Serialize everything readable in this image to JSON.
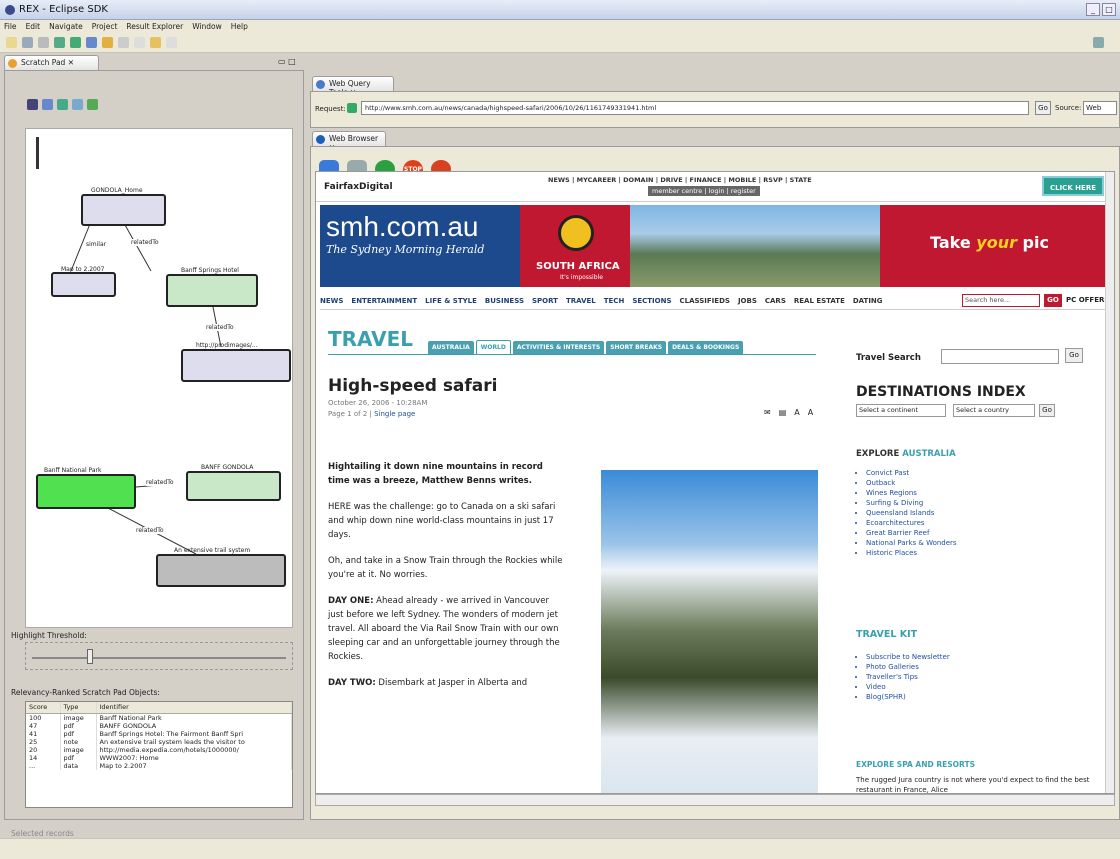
{
  "window": {
    "title": "REX - Eclipse SDK"
  },
  "menu": [
    "File",
    "Edit",
    "Navigate",
    "Project",
    "Result Explorer",
    "Window",
    "Help"
  ],
  "scratch": {
    "tab": "Scratch Pad",
    "nodes": [
      {
        "title": "GONDOLA_Home",
        "label": ""
      },
      {
        "title": "Map to 2.2007",
        "label": "image"
      },
      {
        "title": "Banff Springs Hotel",
        "label": ""
      },
      {
        "title": "http://prodimages/...",
        "label": ""
      },
      {
        "title": "Banff National Park",
        "label": "image"
      },
      {
        "title": "BANFF GONDOLA",
        "label": ""
      },
      {
        "title": "An extensive trail system",
        "label": ""
      }
    ],
    "edges": [
      "similar",
      "relatedTo",
      "relatedTo",
      "relatedTo",
      "relatedTo"
    ],
    "threshold_label": "Highlight Threshold:",
    "threshold_value": 0.22,
    "ranked_label": "Relevancy-Ranked Scratch Pad Objects:",
    "columns": [
      "Score",
      "Type",
      "Identifier"
    ],
    "rows": [
      [
        "100",
        "image",
        "Banff National Park"
      ],
      [
        "47",
        "pdf",
        "BANFF GONDOLA"
      ],
      [
        "41",
        "pdf",
        "Banff Springs Hotel: The Fairmont Banff Spri"
      ],
      [
        "25",
        "note",
        "An extensive trail system leads the visitor to"
      ],
      [
        "20",
        "image",
        "http://media.expedia.com/hotels/1000000/"
      ],
      [
        "14",
        "pdf",
        "WWW2007: Home"
      ],
      [
        "...",
        "data",
        "Map to 2.2007"
      ]
    ],
    "status": "Selected records"
  },
  "query": {
    "tab": "Web Query Tools",
    "request_label": "Request:",
    "url": "http://www.smh.com.au/news/canada/highspeed-safari/2006/10/26/1161749331941.html",
    "go": "Go",
    "source_label": "Source:",
    "source_value": "Web"
  },
  "browser": {
    "tab": "Web Browser",
    "top_links": "NEWS | MYCAREER | DOMAIN | DRIVE | FINANCE | MOBILE | RSVP | STATE",
    "member": "member centre | login | register",
    "fairfax": "FairfaxDigital",
    "click_here": "CLICK HERE",
    "smh": "smh.com.au",
    "smh_sub": "The Sydney Morning Herald",
    "sa": "SOUTH AFRICA",
    "sa_sub": "It's impossible",
    "banner_a": "Take ",
    "banner_b": "your",
    "banner_c": " pic",
    "nav": [
      "NEWS",
      "ENTERTAINMENT",
      "LIFE & STYLE",
      "BUSINESS",
      "SPORT",
      "TRAVEL",
      "TECH",
      "SECTIONS",
      "CLASSIFIEDS",
      "JOBS",
      "CARS",
      "REAL ESTATE",
      "DATING"
    ],
    "search_ph": "Search here...",
    "go": "GO",
    "pc_offers": "PC OFFERS",
    "section": "TRAVEL",
    "section_tabs": [
      "AUSTRALIA",
      "WORLD",
      "ACTIVITIES & INTERESTS",
      "SHORT BREAKS",
      "DEALS & BOOKINGS"
    ],
    "headline": "High-speed safari",
    "date": "October 26, 2006 - 10:28AM",
    "page": "Page 1 of 2 | ",
    "single_page": "Single page",
    "lede": "Hightailing it down nine mountains in record time was a breeze, Matthew Benns writes.",
    "p1": "HERE was the challenge: go to Canada on a ski safari and whip down nine world-class mountains in just 17 days.",
    "p2": "Oh, and take in a Snow Train through the Rockies while you're at it. No worries.",
    "p3_b": "DAY ONE:",
    "p3": " Ahead already - we arrived in Vancouver just before we left Sydney. The wonders of modern jet travel. All aboard the Via Rail Snow Train with our own sleeping car and an unforgettable journey through the Rockies.",
    "p4_b": "DAY TWO:",
    "p4": " Disembark at Jasper in Alberta and",
    "travel_search": "Travel Search",
    "travel_go": "Go",
    "dest": "DESTINATIONS INDEX",
    "sel1": "Select a continent",
    "sel2": "Select a country",
    "sel_go": "Go",
    "explore_a": "EXPLORE ",
    "explore_b": "AUSTRALIA",
    "explore_items": [
      "Convict Past",
      "Outback",
      "Wines Regions",
      "Surfing & Diving",
      "Queensland Islands",
      "Ecoarchitectures",
      "Great Barrier Reef",
      "National Parks & Wonders",
      "Historic Places"
    ],
    "kit": "TRAVEL KIT",
    "kit_items": [
      "Subscribe to Newsletter",
      "Photo Galleries",
      "Traveller's Tips",
      "Video",
      "Blog(SPHR)"
    ],
    "spa": "EXPLORE SPA AND RESORTS",
    "spa_text": "The rugged Jura country is not where you'd expect to find the best restaurant in France, Alice"
  }
}
